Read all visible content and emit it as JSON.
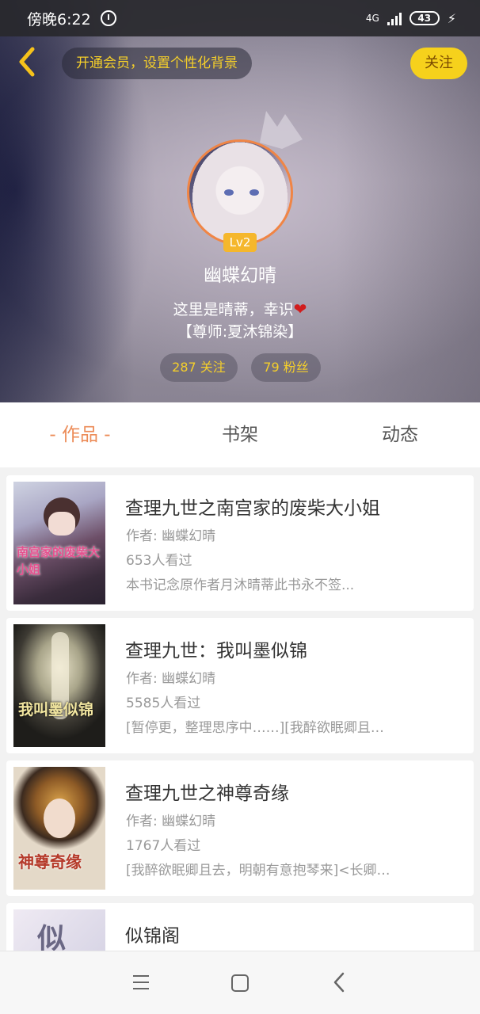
{
  "status_bar": {
    "time": "傍晚6:22",
    "network": "4G",
    "battery": "43"
  },
  "header": {
    "vip_banner": "开通会员，设置个性化背景",
    "follow_label": "关注",
    "level": "Lv2",
    "username": "幽蝶幻晴",
    "bio_line1": "这里是晴蒂，幸识",
    "bio_line2": "【尊师:夏沐锦染】",
    "following": "287 关注",
    "followers": "79 粉丝"
  },
  "tabs": [
    {
      "label": "- 作品 -",
      "active": true
    },
    {
      "label": "书架",
      "active": false
    },
    {
      "label": "动态",
      "active": false
    }
  ],
  "books": [
    {
      "title": "查理九世之南宫家的废柴大小姐",
      "author": "作者: 幽蝶幻晴",
      "views": "653人看过",
      "desc": "本书记念原作者月沐晴蒂此书永不签...",
      "cover_text": "南宫家的废柴大小姐"
    },
    {
      "title": "查理九世：我叫墨似锦",
      "author": "作者: 幽蝶幻晴",
      "views": "5585人看过",
      "desc": "[暂停更，整理思序中……][我醉欲眠卿且…",
      "cover_text": "我叫墨似锦"
    },
    {
      "title": "查理九世之神尊奇缘",
      "author": "作者: 幽蝶幻晴",
      "views": "1767人看过",
      "desc": "[我醉欲眠卿且去，明朝有意抱琴来]<长卿…",
      "cover_text": "神尊奇缘"
    },
    {
      "title": "似锦阁",
      "author": "",
      "views": "",
      "desc": "",
      "cover_text": "似"
    }
  ],
  "colors": {
    "accent": "#ec8b57",
    "gold": "#f6d11c",
    "badge": "#f5b72c"
  },
  "icons": [
    "back-icon",
    "alarm-icon",
    "signal-icon",
    "battery-icon",
    "crown-icon",
    "heart-icon",
    "menu-icon",
    "home-icon",
    "nav-back-icon"
  ]
}
